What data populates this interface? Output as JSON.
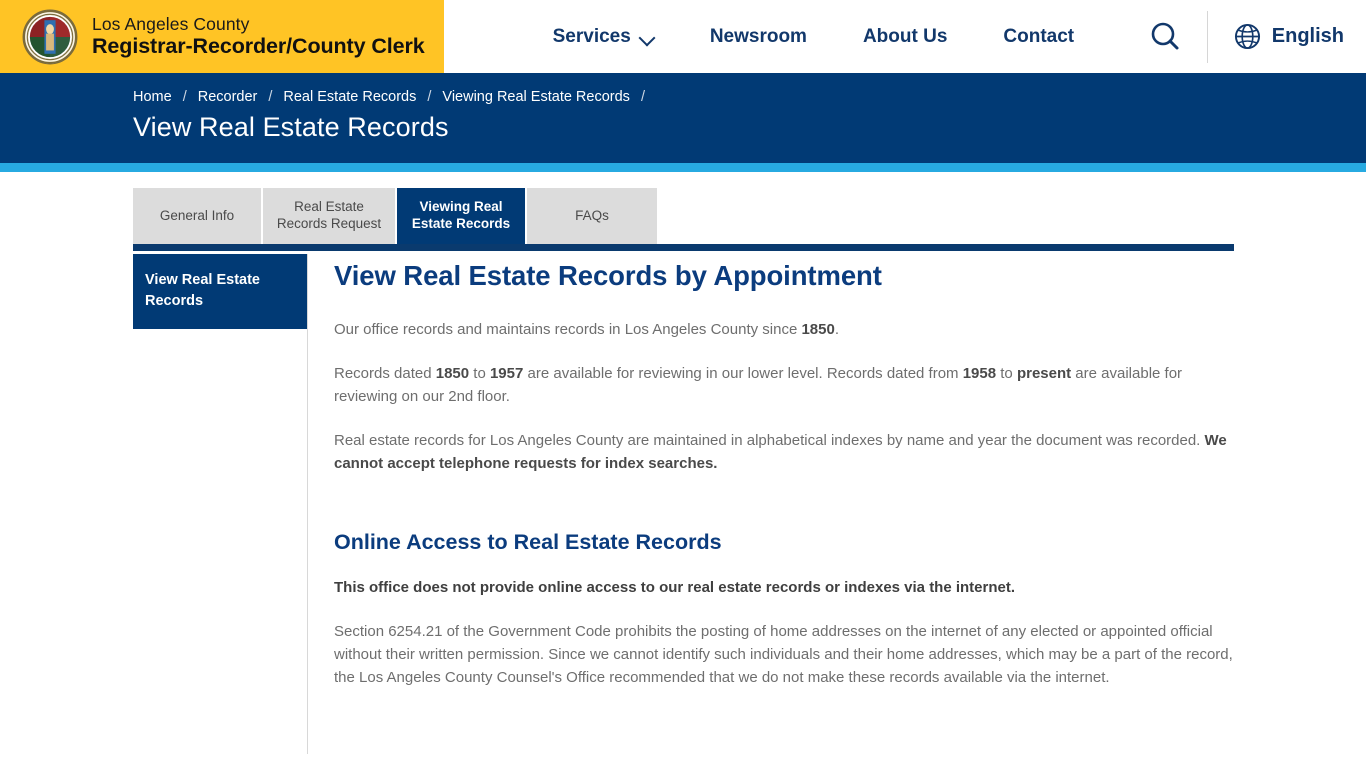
{
  "header": {
    "brand": {
      "line1": "Los Angeles County",
      "line2": "Registrar-Recorder/County Clerk",
      "seal_icon": "la-county-seal-icon"
    },
    "nav": [
      {
        "label": "Services",
        "has_dropdown": true
      },
      {
        "label": "Newsroom",
        "has_dropdown": false
      },
      {
        "label": "About Us",
        "has_dropdown": false
      },
      {
        "label": "Contact",
        "has_dropdown": false
      }
    ],
    "search_icon": "search-icon",
    "language": {
      "label": "English",
      "icon": "globe-icon"
    },
    "brand_bg": "#FFC425",
    "nav_color": "#12386B"
  },
  "breadcrumb": {
    "items": [
      "Home",
      "Recorder",
      "Real Estate Records",
      "Viewing Real Estate Records"
    ],
    "separator": "/",
    "trailing_separator": "/"
  },
  "page": {
    "title": "View Real Estate Records",
    "band_bg": "#013A75",
    "accent_color": "#27AAE1"
  },
  "tabs": [
    {
      "label": "General Info",
      "active": false
    },
    {
      "label": "Real Estate Records Request",
      "active": false
    },
    {
      "label": "Viewing Real Estate Records",
      "active": true
    },
    {
      "label": "FAQs",
      "active": false
    }
  ],
  "sidebar": {
    "items": [
      {
        "label": "View Real Estate Records",
        "active": true
      }
    ]
  },
  "main": {
    "heading": "View Real Estate Records by Appointment",
    "paragraph1": {
      "part1": "Our office records and maintains records in Los Angeles County since ",
      "bold1": "1850",
      "part2": "."
    },
    "paragraph2": {
      "part1": "Records dated ",
      "bold1": "1850",
      "part2": " to ",
      "bold2": "1957",
      "part3": " are available for reviewing in our lower level. Records dated from ",
      "bold3": "1958",
      "part4": " to ",
      "bold4": "present",
      "part5": " are available for reviewing on our 2nd floor."
    },
    "paragraph3": {
      "part1": "Real estate records for Los Angeles County are maintained in alphabetical indexes by name and year the document was recorded. ",
      "bold1": "We cannot accept telephone requests for index searches."
    },
    "heading2": "Online Access to Real Estate Records",
    "paragraph4": "This office does not provide online access to our real estate records or indexes via the internet.",
    "paragraph5": "Section 6254.21 of the Government Code prohibits the posting of home addresses on the internet of any elected or appointed official without their written permission. Since we cannot identify such individuals and their home addresses, which may be a part of the record, the Los Angeles County Counsel's Office recommended that we do not make these records available via the internet."
  }
}
